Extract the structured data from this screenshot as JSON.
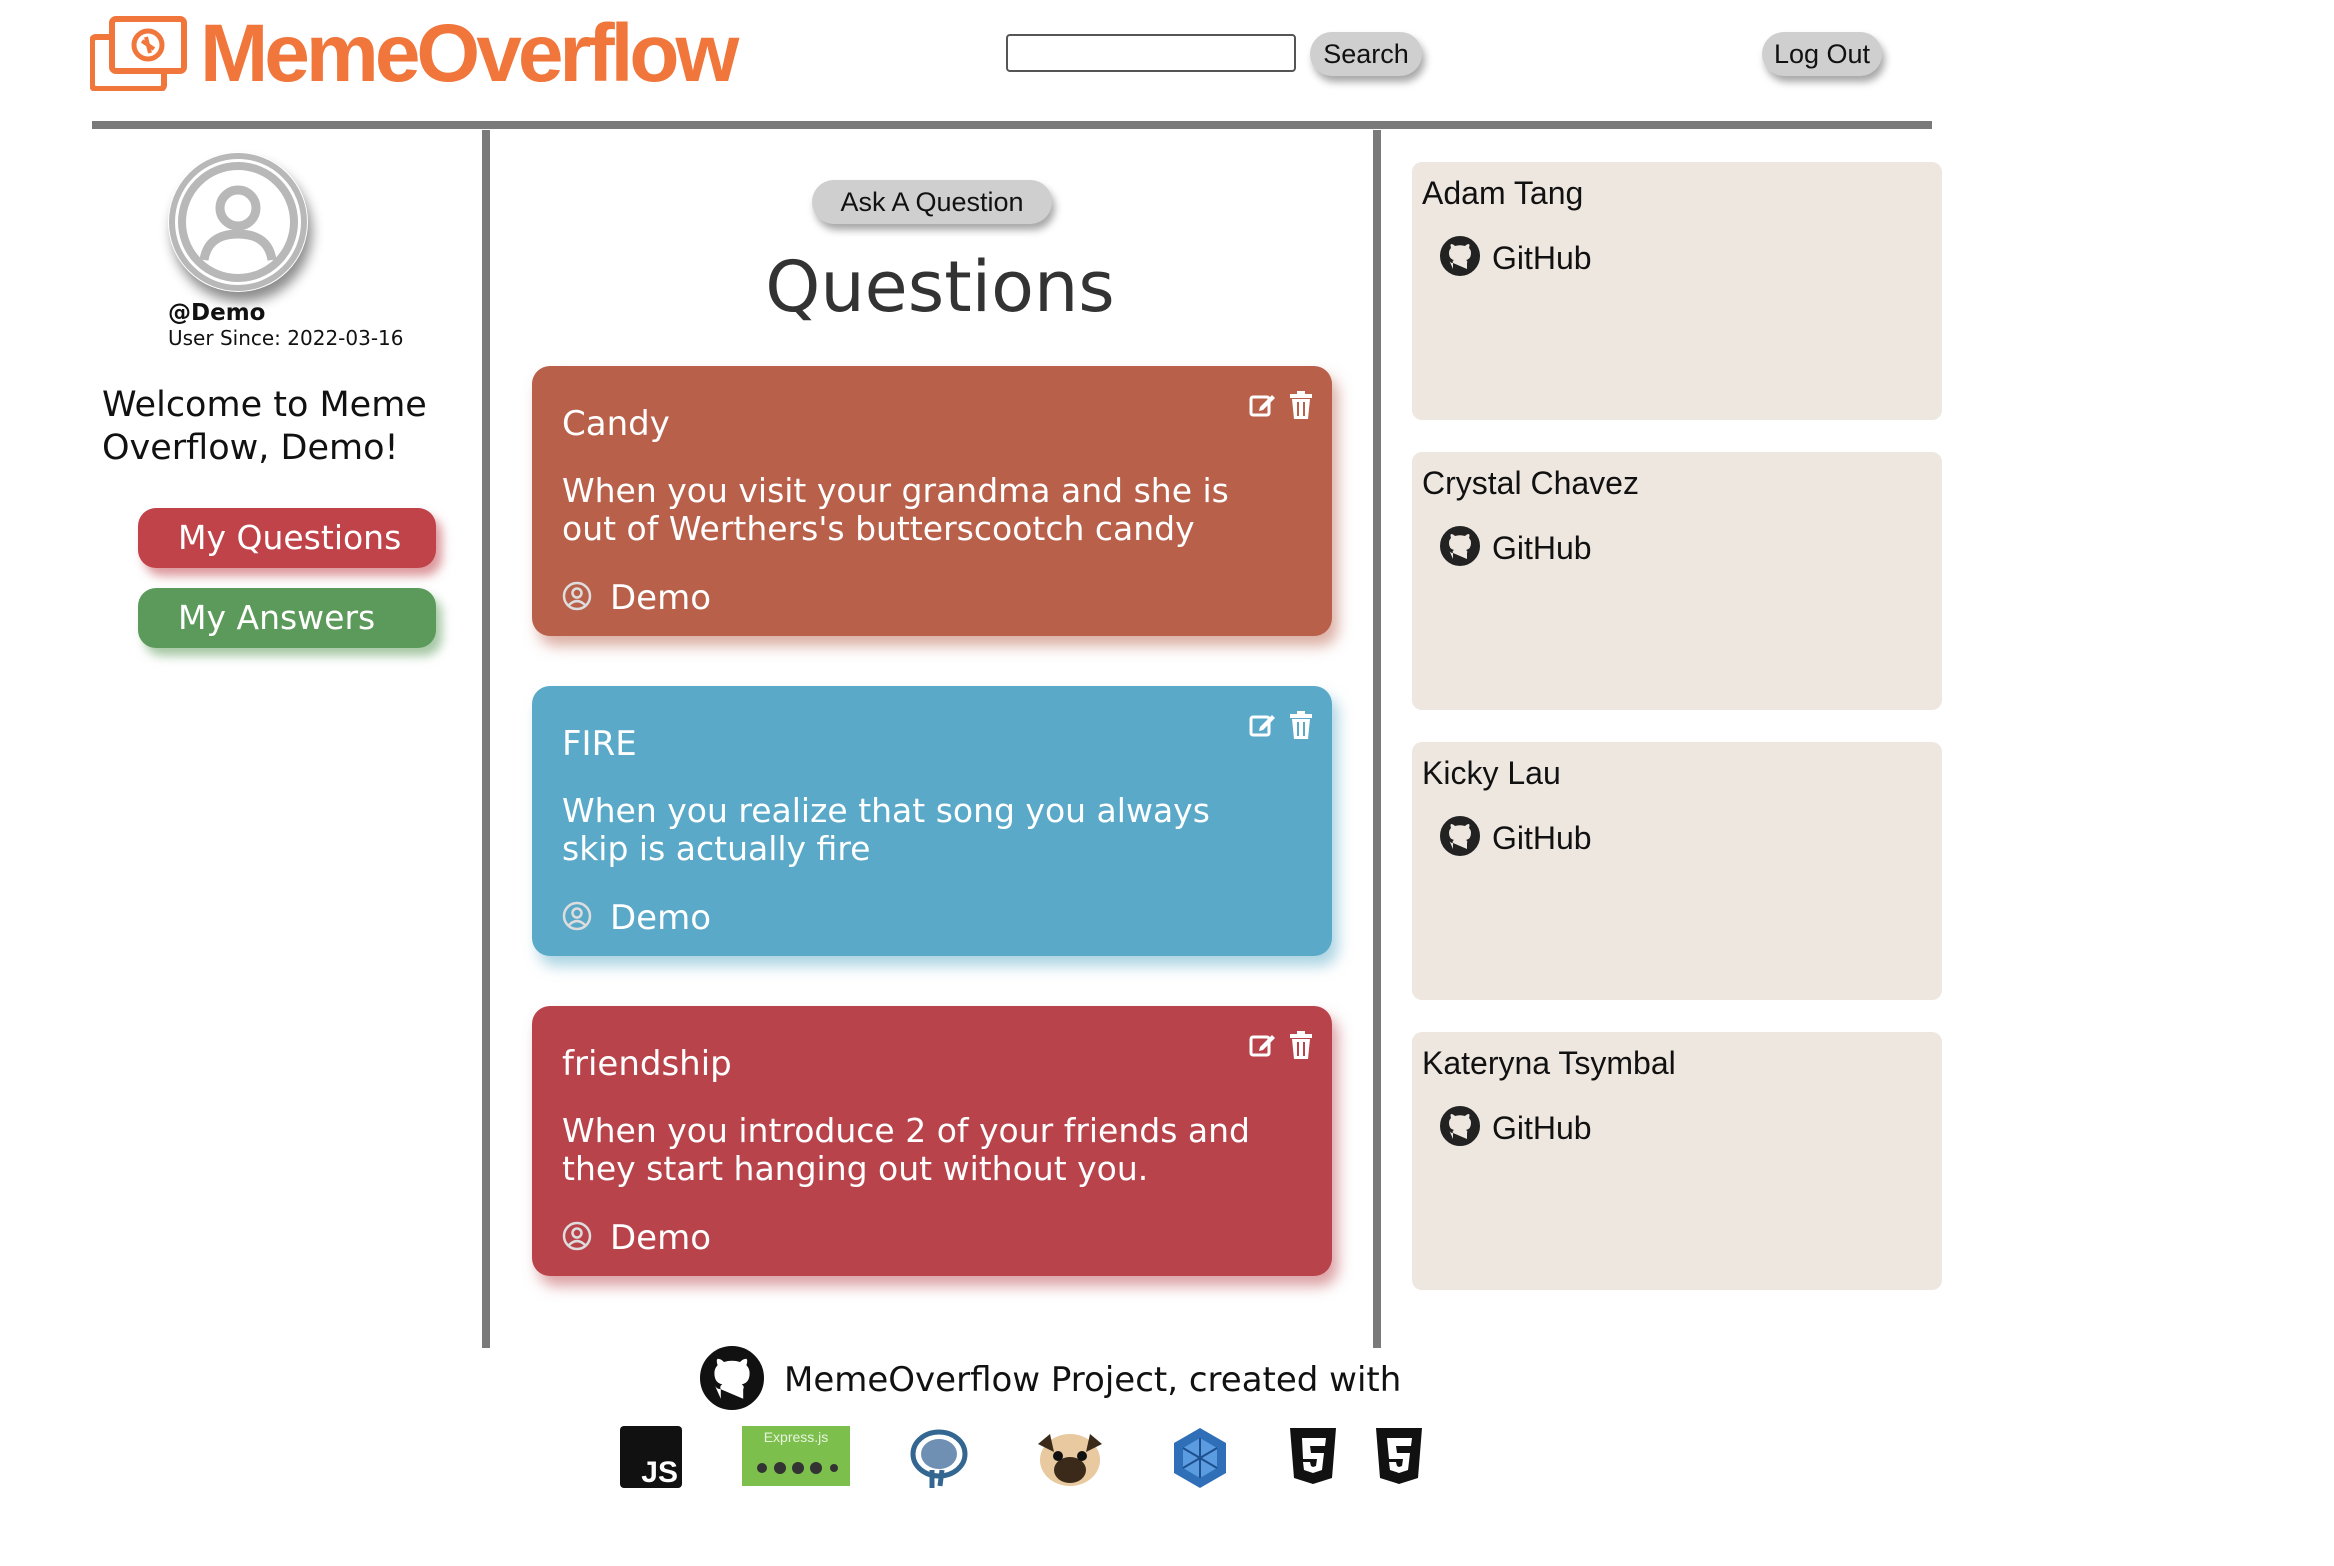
{
  "header": {
    "logo_text": "MemeOverflow",
    "search_placeholder": "",
    "search_label": "Search",
    "logout_label": "Log Out"
  },
  "sidebar": {
    "handle": "@Demo",
    "user_since": "User Since: 2022-03-16",
    "welcome": "Welcome to Meme Overflow, Demo!",
    "my_questions_label": "My Questions",
    "my_answers_label": "My Answers"
  },
  "main": {
    "ask_label": "Ask A Question",
    "title": "Questions",
    "questions": [
      {
        "title": "Candy",
        "body": "When you visit your grandma and she is out of Werthers's butterscootch candy",
        "author": "Demo",
        "color": "#b9604a"
      },
      {
        "title": "FIRE",
        "body": "When you realize that song you always skip is actually fire",
        "author": "Demo",
        "color": "#5aa9c8"
      },
      {
        "title": "friendship",
        "body": "When you introduce 2 of your friends and they start hanging out without you.",
        "author": "Demo",
        "color": "#b9434a"
      }
    ]
  },
  "developers": [
    {
      "name": "Adam Tang",
      "link": "GitHub"
    },
    {
      "name": "Crystal Chavez",
      "link": "GitHub"
    },
    {
      "name": "Kicky Lau",
      "link": "GitHub"
    },
    {
      "name": "Kateryna Tsymbal",
      "link": "GitHub"
    }
  ],
  "footer": {
    "text": "MemeOverflow Project, created with",
    "tech_icons": [
      "javascript-icon",
      "express-node-icon",
      "postgresql-icon",
      "pug-icon",
      "sequelize-icon",
      "html5-icon",
      "css3-icon"
    ],
    "tech_express_label": "Express.js",
    "tech_js_label": "JS"
  },
  "colors": {
    "brand": "#f0763b",
    "my_questions": "#c0434a",
    "my_answers": "#5c9a5b",
    "dev_card_bg": "#eee7e0"
  }
}
